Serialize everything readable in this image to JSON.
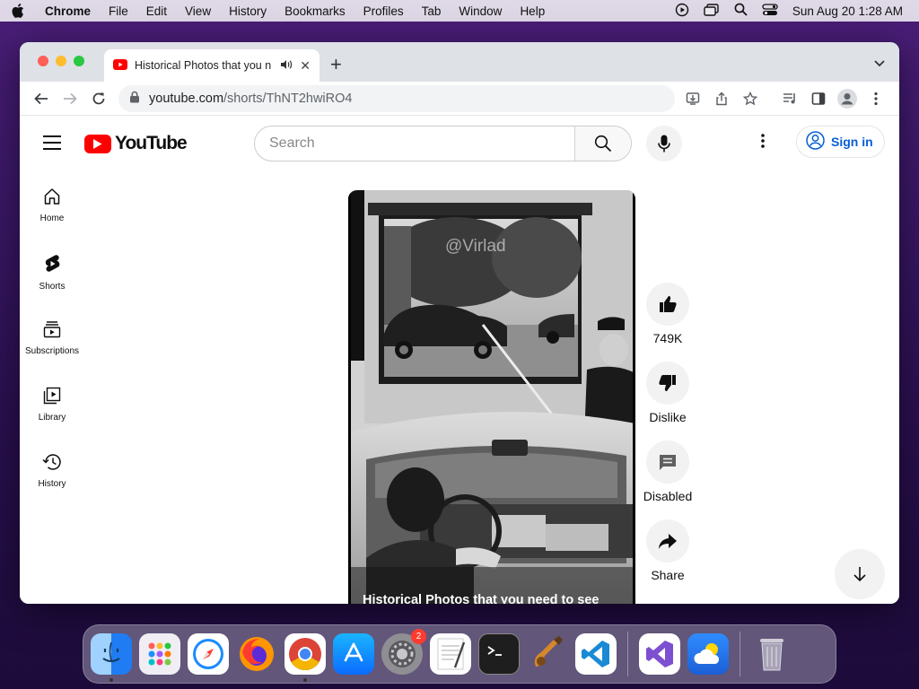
{
  "menubar": {
    "app": "Chrome",
    "items": [
      "File",
      "Edit",
      "View",
      "History",
      "Bookmarks",
      "Profiles",
      "Tab",
      "Window",
      "Help"
    ],
    "clock": "Sun Aug 20  1:28 AM"
  },
  "browser": {
    "tab_title": "Historical Photos that you n",
    "url_host": "youtube.com",
    "url_path": "/shorts/ThNT2hwiRO4"
  },
  "youtube": {
    "logo_text": "YouTube",
    "search_placeholder": "Search",
    "signin_label": "Sign in",
    "nav": [
      {
        "label": "Home",
        "icon": "home-icon"
      },
      {
        "label": "Shorts",
        "icon": "shorts-icon"
      },
      {
        "label": "Subscriptions",
        "icon": "subscriptions-icon"
      },
      {
        "label": "Library",
        "icon": "library-icon"
      },
      {
        "label": "History",
        "icon": "history-icon"
      }
    ],
    "video": {
      "watermark": "@Virlad",
      "caption": "Historical Photos that you need to see"
    },
    "actions": {
      "like": "749K",
      "dislike": "Dislike",
      "comments": "Disabled",
      "share": "Share"
    }
  },
  "dock": {
    "apps": [
      "Finder",
      "Launchpad",
      "Safari",
      "Firefox",
      "Chrome",
      "App Store",
      "System Settings",
      "TextEdit",
      "Terminal",
      "Instruments",
      "Visual Studio Code",
      "Visual Studio",
      "Weather",
      "Trash"
    ],
    "settings_badge": "2"
  }
}
